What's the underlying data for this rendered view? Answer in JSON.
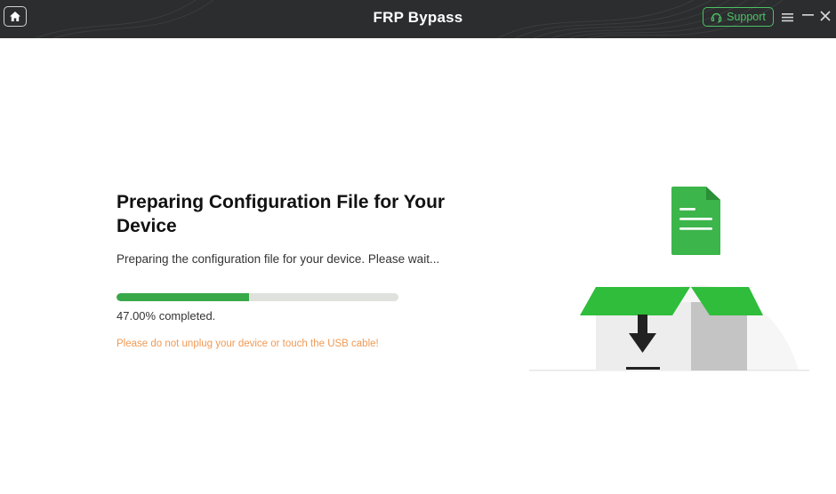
{
  "titlebar": {
    "title": "FRP Bypass",
    "support_label": "Support"
  },
  "main": {
    "heading": "Preparing Configuration File for Your Device",
    "subtext": "Preparing the configuration file for your device. Please wait...",
    "progress": {
      "fraction": 0.47,
      "label": "47.00% completed."
    },
    "warning": "Please do not unplug your device or touch the USB cable!"
  },
  "colors": {
    "titlebar_bg": "#2b2d2f",
    "accent_green": "#38a849",
    "support_green": "#4cc264",
    "warning_orange": "#ef9a55",
    "progress_track": "#dfe2dc"
  },
  "icons": {
    "home": "home-icon",
    "support": "headset-icon",
    "menu": "menu-icon",
    "minimize": "minimize-icon",
    "close": "close-icon",
    "document": "document-icon",
    "box": "box-download-illustration"
  }
}
